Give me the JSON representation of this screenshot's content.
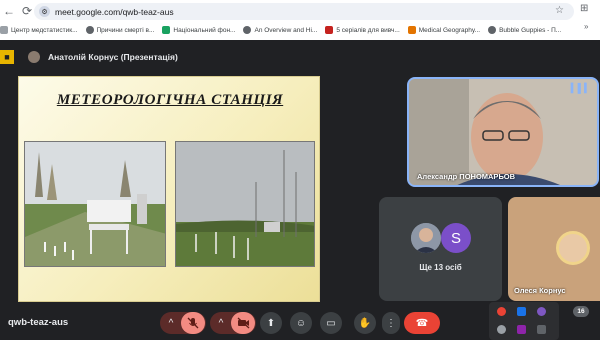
{
  "browser": {
    "url": "meet.google.com/qwb-teaz-aus",
    "bookmarks": [
      {
        "label": "Центр медстатистик...",
        "color": "#8e8e8e"
      },
      {
        "label": "Причини смерті в...",
        "color": "#5f6368"
      },
      {
        "label": "Національний фон...",
        "color": "#1aa260"
      },
      {
        "label": "An Overview and Hi...",
        "color": "#5f6368"
      },
      {
        "label": "5 серіалів для вивч...",
        "color": "#c5221f"
      },
      {
        "label": "Medical Geography...",
        "color": "#e37400"
      },
      {
        "label": "Bubble Guppies - П...",
        "color": "#5f6368"
      }
    ],
    "bookmarks_more": "»"
  },
  "meet": {
    "presenter_label": "Анатолій Корнус (Презентація)",
    "slide_title": "МЕТЕОРОЛОГІЧНА СТАНЦІЯ",
    "tiles": {
      "main_participant": "Александр ПОНОМАРЬОВ",
      "others_avatar_letter": "S",
      "others_count": "Ще 13 осіб",
      "last_participant": "Олеся Корнус"
    },
    "meeting_code": "qwb-teaz-aus",
    "participants_badge": "16"
  },
  "colors": {
    "meet_bg": "#202124",
    "mute_red": "#f28b82",
    "end_call": "#ea4335",
    "active_border": "#8ab4f8"
  },
  "icons": [
    "back-icon",
    "refresh-icon",
    "site-info-icon",
    "star-icon",
    "chevron-up-icon",
    "mic-off-icon",
    "camera-off-icon",
    "present-icon",
    "emoji-icon",
    "captions-icon",
    "hand-icon",
    "more-icon",
    "end-call-icon",
    "audio-wave-icon"
  ]
}
